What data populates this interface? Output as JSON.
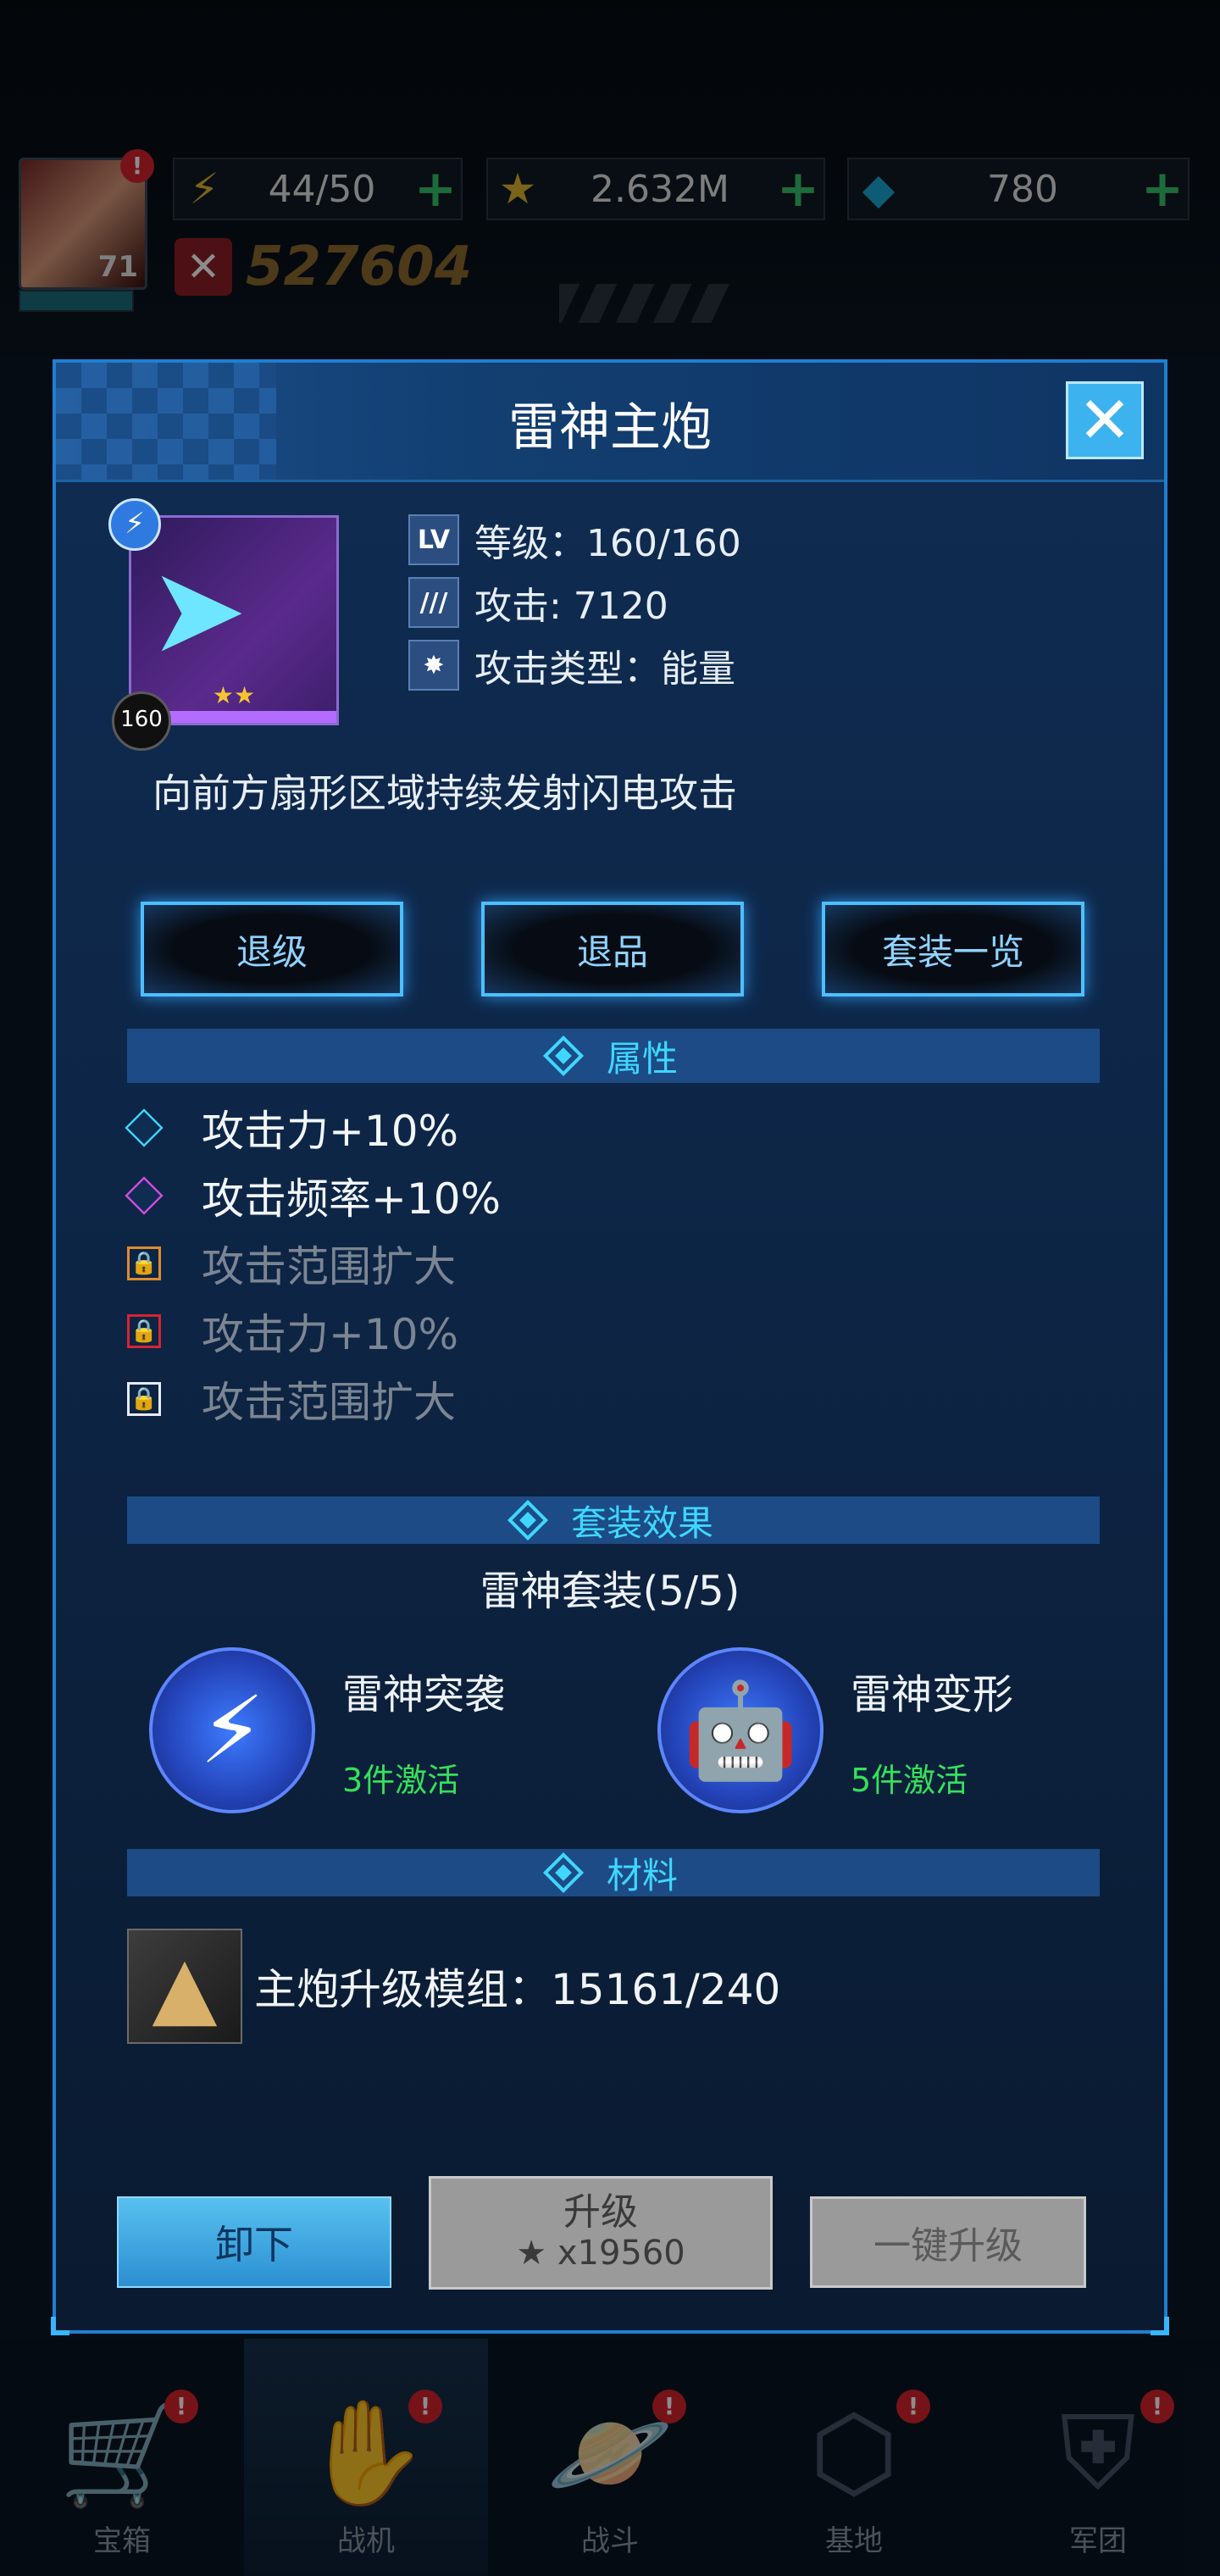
{
  "status": {
    "player_level": "71",
    "energy": "44/50",
    "stars": "2.632M",
    "gems": "780",
    "power": "527604",
    "alert": "!"
  },
  "dialog": {
    "title": "雷神主炮",
    "close_icon": "close-icon",
    "item": {
      "level_badge": "160",
      "stars": "★★",
      "level_tag": "LV",
      "level_text": "等级：160/160",
      "attack_text": "攻击: 7120",
      "type_text": "攻击类型：能量",
      "description": "向前方扇形区域持续发射闪电攻击"
    },
    "buttons": {
      "downgrade": "退级",
      "downrank": "退品",
      "set_overview": "套装一览"
    },
    "sections": {
      "attributes": "属性",
      "set_effect": "套装效果",
      "materials": "材料"
    },
    "attributes": [
      {
        "text": "攻击力+10%",
        "active": true,
        "color": "#3fd7ff"
      },
      {
        "text": "攻击频率+10%",
        "active": true,
        "color": "#d44bdc"
      },
      {
        "text": "攻击范围扩大",
        "active": false,
        "color": "#e08a2c"
      },
      {
        "text": "攻击力+10%",
        "active": false,
        "color": "#d8242f"
      },
      {
        "text": "攻击范围扩大",
        "active": false,
        "color": "#e6ecf7"
      }
    ],
    "set": {
      "name": "雷神套装(5/5)",
      "effects": [
        {
          "title": "雷神突袭",
          "requirement": "3件激活"
        },
        {
          "title": "雷神变形",
          "requirement": "5件激活"
        }
      ]
    },
    "material": {
      "text": "主炮升级模组：15161/240"
    },
    "footer": {
      "unequip": "卸下",
      "upgrade": "升级",
      "upgrade_cost": "★ x19560",
      "one_click_upgrade": "一键升级"
    }
  },
  "nav": [
    {
      "label": "宝箱",
      "icon": "chest-cart-icon"
    },
    {
      "label": "战机",
      "icon": "mech-hand-icon"
    },
    {
      "label": "战斗",
      "icon": "planet-icon"
    },
    {
      "label": "基地",
      "icon": "base-hex-icon"
    },
    {
      "label": "军团",
      "icon": "legion-crest-icon"
    }
  ]
}
